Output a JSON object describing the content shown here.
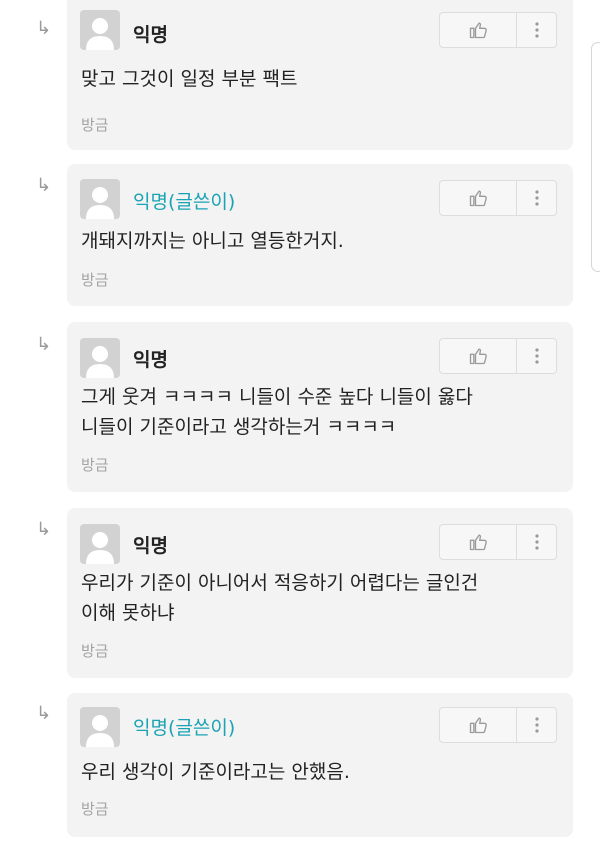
{
  "comments": [
    {
      "author": "익명",
      "is_op": false,
      "content": "맞고 그것이 일정 부분 팩트",
      "time": "방금"
    },
    {
      "author": "익명(글쓴이)",
      "is_op": true,
      "content": "개돼지까지는 아니고 열등한거지.",
      "time": "방금"
    },
    {
      "author": "익명",
      "is_op": false,
      "content": "그게 웃겨 ㅋㅋㅋㅋ 니들이 수준 높다 니들이 옳다\n니들이 기준이라고 생각하는거 ㅋㅋㅋㅋ",
      "time": "방금"
    },
    {
      "author": "익명",
      "is_op": false,
      "content": "우리가 기준이 아니어서 적응하기 어렵다는 글인건\n이해 못하냐",
      "time": "방금"
    },
    {
      "author": "익명(글쓴이)",
      "is_op": true,
      "content": "우리 생각이 기준이라고는 안했음.",
      "time": "방금"
    }
  ],
  "icons": {
    "reply": "reply-arrow-icon",
    "like": "thumbs-up-icon",
    "more": "more-vertical-icon",
    "avatar": "default-user-avatar-icon"
  },
  "colors": {
    "op_author": "#1aa3b5",
    "card_bg": "#f3f3f3",
    "time_text": "#a3a3a3"
  }
}
